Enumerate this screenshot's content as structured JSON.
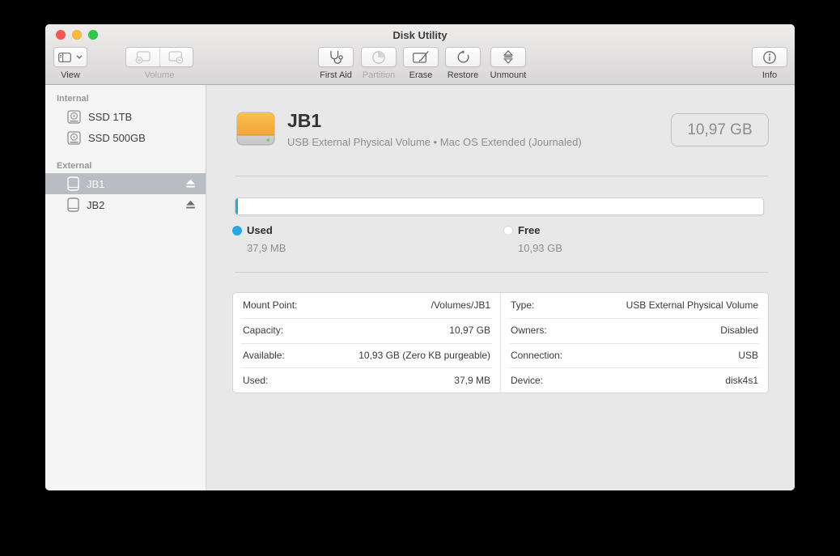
{
  "window": {
    "title": "Disk Utility",
    "traffic_lights": {
      "close": "#fc5753",
      "minimize": "#fdbc40",
      "maximize": "#33c748"
    }
  },
  "toolbar": {
    "view": {
      "label": "View",
      "icon": "sidebar-toggle-icon",
      "enabled": true
    },
    "volume": {
      "label": "Volume",
      "icons": [
        "add-volume-icon",
        "remove-volume-icon"
      ],
      "enabled": false
    },
    "actions": [
      {
        "label": "First Aid",
        "icon": "stethoscope-icon",
        "enabled": true
      },
      {
        "label": "Partition",
        "icon": "pie-chart-icon",
        "enabled": false
      },
      {
        "label": "Erase",
        "icon": "erase-icon",
        "enabled": true
      },
      {
        "label": "Restore",
        "icon": "restore-icon",
        "enabled": true
      },
      {
        "label": "Unmount",
        "icon": "unmount-icon",
        "enabled": true
      }
    ],
    "info": {
      "label": "Info",
      "icon": "info-icon",
      "enabled": true
    }
  },
  "sidebar": {
    "sections": [
      {
        "label": "Internal",
        "items": [
          {
            "name": "SSD 1TB",
            "icon": "internal-drive-icon"
          },
          {
            "name": "SSD 500GB",
            "icon": "internal-drive-icon"
          }
        ]
      },
      {
        "label": "External",
        "items": [
          {
            "name": "JB1",
            "icon": "external-drive-icon",
            "selected": true,
            "ejectable": true
          },
          {
            "name": "JB2",
            "icon": "external-drive-icon",
            "selected": false,
            "ejectable": true
          }
        ]
      }
    ]
  },
  "main": {
    "header": {
      "title": "JB1",
      "subtitle": "USB External Physical Volume • Mac OS Extended (Journaled)",
      "capacity": "10,97 GB"
    },
    "usage": {
      "used_percent": 0.5,
      "legend": [
        {
          "label": "Used",
          "value": "37,9 MB",
          "color": "#27a8e0"
        },
        {
          "label": "Free",
          "value": "10,93 GB",
          "color": "#ffffff"
        }
      ]
    },
    "details": {
      "left": [
        {
          "label": "Mount Point:",
          "value": "/Volumes/JB1"
        },
        {
          "label": "Capacity:",
          "value": "10,97 GB"
        },
        {
          "label": "Available:",
          "value": "10,93 GB (Zero KB purgeable)"
        },
        {
          "label": "Used:",
          "value": "37,9 MB"
        }
      ],
      "right": [
        {
          "label": "Type:",
          "value": "USB External Physical Volume"
        },
        {
          "label": "Owners:",
          "value": "Disabled"
        },
        {
          "label": "Connection:",
          "value": "USB"
        },
        {
          "label": "Device:",
          "value": "disk4s1"
        }
      ]
    }
  }
}
